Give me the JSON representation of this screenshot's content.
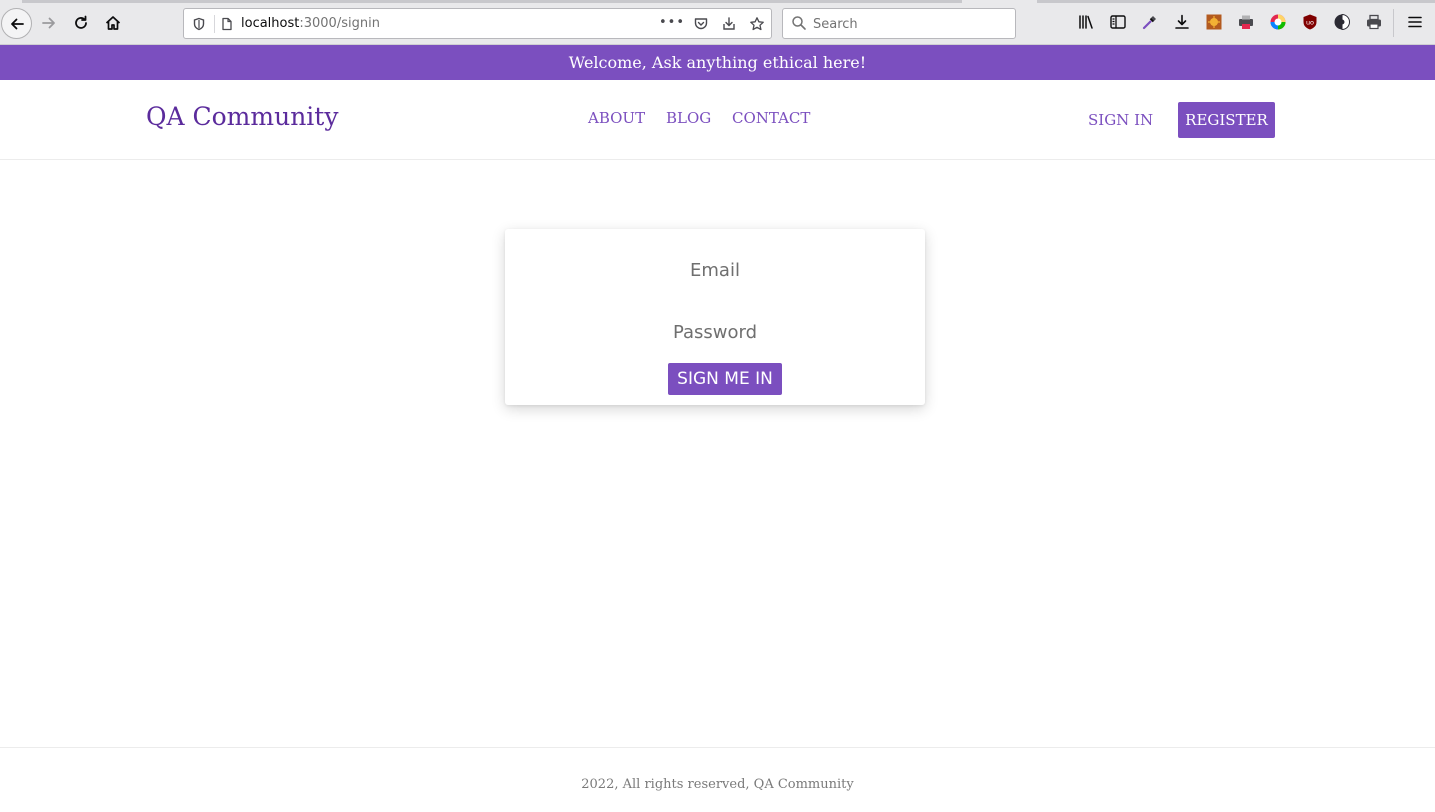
{
  "browser": {
    "url_host": "localhost",
    "url_path": ":3000/signin",
    "search_placeholder": "Search",
    "page_actions_label": "•••"
  },
  "banner": {
    "text": "Welcome, Ask anything ethical here!"
  },
  "header": {
    "brand": "QA Community",
    "nav": [
      "ABOUT",
      "BLOG",
      "CONTACT"
    ],
    "signin_label": "SIGN IN",
    "register_label": "REGISTER"
  },
  "signin_form": {
    "email_placeholder": "Email",
    "password_placeholder": "Password",
    "submit_label": "SIGN ME IN"
  },
  "footer": {
    "text": "2022, All rights reserved, QA Community"
  },
  "colors": {
    "accent": "#7b4fbf",
    "brand": "#5b2b9c",
    "banner_text": "#ffffff",
    "footer_text": "#7a7a7a"
  },
  "icons": {
    "toolbar": [
      "back-icon",
      "forward-icon",
      "reload-icon",
      "home-icon",
      "shield-icon",
      "page-icon",
      "pocket-icon",
      "download-arrow-icon",
      "star-icon",
      "search-icon",
      "library-icon",
      "sidebar-icon",
      "eyedropper-icon",
      "download-icon",
      "extension-icon",
      "printer-icon",
      "color-icon",
      "ublock-icon",
      "theme-icon",
      "print-icon",
      "menu-icon"
    ]
  }
}
